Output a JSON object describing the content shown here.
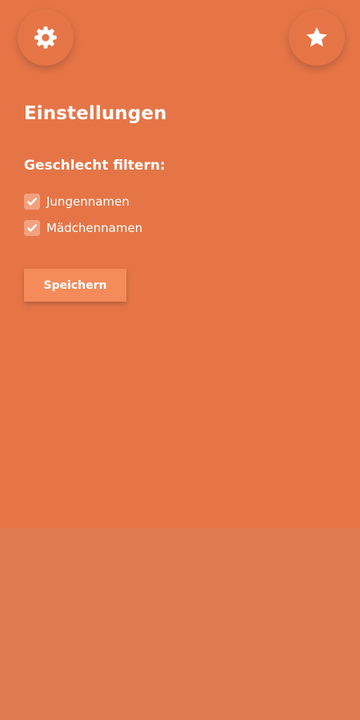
{
  "header": {
    "settings_icon": "gear-icon",
    "favorites_icon": "star-icon"
  },
  "settings": {
    "title": "Einstellungen",
    "filter_heading": "Geschlecht filtern:",
    "options": [
      {
        "label": "Jungennamen",
        "checked": true
      },
      {
        "label": "Mädchennamen",
        "checked": true
      }
    ],
    "save_label": "Speichern"
  },
  "colors": {
    "background": "#e57547",
    "bottom_area": "#df7b51",
    "button": "#f58a5a",
    "checkbox": "#f2a07e",
    "text": "#ffffff"
  }
}
